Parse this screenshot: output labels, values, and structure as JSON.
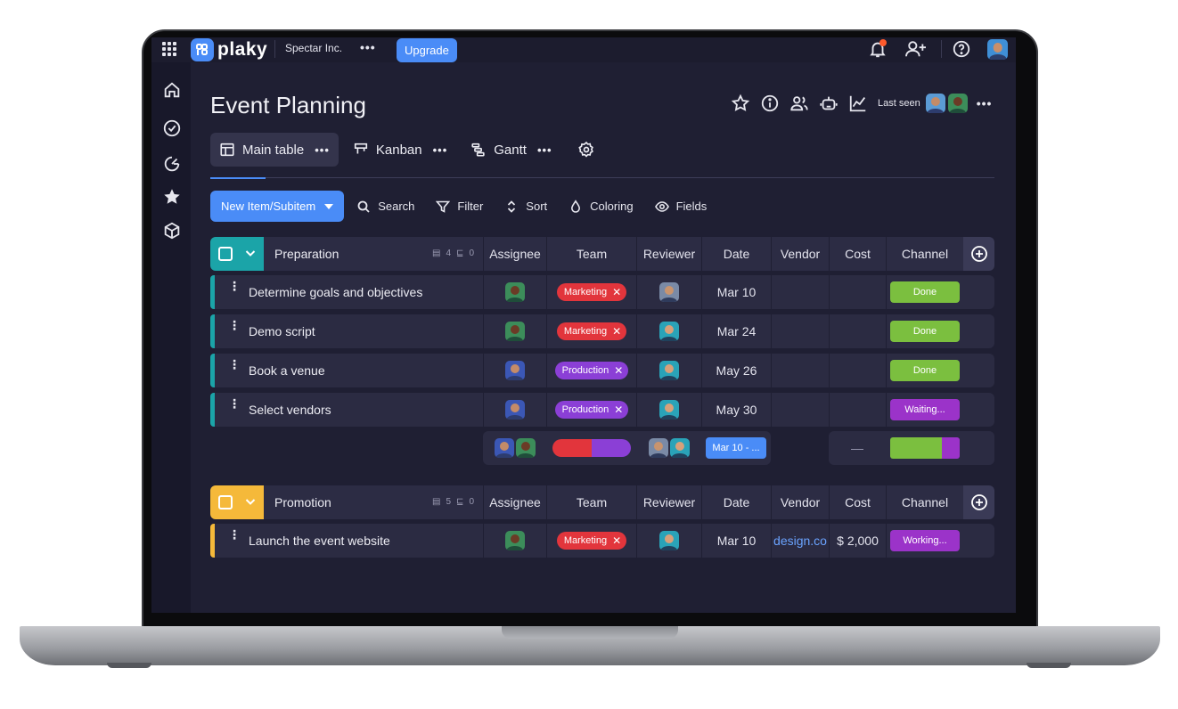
{
  "topbar": {
    "brand": "plaky",
    "org": "Spectar Inc.",
    "upgrade": "Upgrade",
    "icons": [
      "apps-grid-icon",
      "bell-icon",
      "add-user-icon",
      "help-icon",
      "avatar"
    ]
  },
  "leftnav": {
    "icons": [
      "home-icon",
      "check-circle-icon",
      "dashboard-icon",
      "star-icon",
      "cube-icon"
    ]
  },
  "board": {
    "title": "Event Planning",
    "last_seen": "Last seen",
    "views": [
      {
        "label": "Main table",
        "icon": "table-icon",
        "active": true
      },
      {
        "label": "Kanban",
        "icon": "kanban-icon",
        "active": false
      },
      {
        "label": "Gantt",
        "icon": "gantt-icon",
        "active": false
      }
    ]
  },
  "toolbar": {
    "new_item": "New Item/Subitem",
    "search": "Search",
    "filter": "Filter",
    "sort": "Sort",
    "coloring": "Coloring",
    "fields": "Fields"
  },
  "columns": [
    "Assignee",
    "Team",
    "Reviewer",
    "Date",
    "Vendor",
    "Cost",
    "Channel"
  ],
  "groups": [
    {
      "name": "Preparation",
      "color": "#1ba4a8",
      "item_count": "4",
      "subitem_count": "0",
      "items": [
        {
          "name": "Determine goals and objectives",
          "team": "Marketing",
          "date": "Mar 10",
          "vendor": "",
          "cost": "",
          "channel": "Done"
        },
        {
          "name": "Demo script",
          "team": "Marketing",
          "date": "Mar 24",
          "vendor": "",
          "cost": "",
          "channel": "Done"
        },
        {
          "name": "Book a venue",
          "team": "Production",
          "date": "May 26",
          "vendor": "",
          "cost": "",
          "channel": "Done"
        },
        {
          "name": "Select vendors",
          "team": "Production",
          "date": "May 30",
          "vendor": "",
          "cost": "",
          "channel": "Waiting..."
        }
      ],
      "summary": {
        "date": "Mar 10 - ...",
        "cost": "—"
      }
    },
    {
      "name": "Promotion",
      "color": "#f5b93a",
      "item_count": "5",
      "subitem_count": "0",
      "items": [
        {
          "name": "Launch the event website",
          "team": "Marketing",
          "date": "Mar 10",
          "vendor": "design.co",
          "cost": "$ 2,000",
          "channel": "Working..."
        }
      ]
    }
  ],
  "colors": {
    "marketing": "#e2353c",
    "production": "#8b3fd6",
    "done": "#7bbf3f",
    "waiting": "#9b33c9",
    "working": "#9b33c9",
    "accent": "#4a8cf7"
  }
}
